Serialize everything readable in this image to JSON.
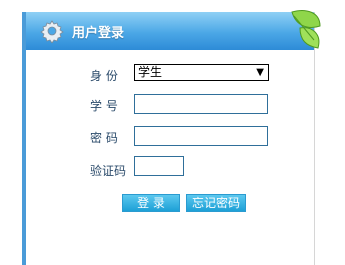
{
  "header": {
    "title": "用户登录"
  },
  "form": {
    "role_label": "身 份",
    "role_value": "学生",
    "id_label": "学 号",
    "id_value": "",
    "password_label": "密 码",
    "password_value": "",
    "captcha_label": "验证码",
    "captcha_value": ""
  },
  "buttons": {
    "login_label": "登 录",
    "forgot_label": "忘记密码"
  },
  "colors": {
    "header_blue": "#4ba7e6",
    "button_blue": "#1da0d6",
    "left_border": "#4a9bd8"
  },
  "icons": {
    "header_icon": "gear-icon",
    "decoration": "leaves-icon",
    "dropdown": "chevron-down-icon"
  }
}
